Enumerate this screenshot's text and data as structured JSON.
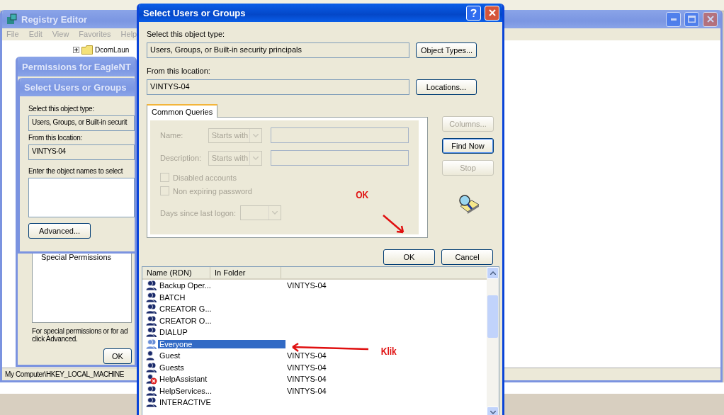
{
  "registry_editor": {
    "title": "Registry Editor",
    "menu": [
      "File",
      "Edit",
      "View",
      "Favorites",
      "Help"
    ],
    "tree_item": "DcomLaun",
    "status": "My Computer\\HKEY_LOCAL_MACHINE"
  },
  "permissions": {
    "title": "Permissions for EagleNT",
    "list_items": [
      "Special Permissions"
    ],
    "note_lines": [
      "For special permissions or for ad",
      "click Advanced."
    ],
    "ok": "OK"
  },
  "back_dialog": {
    "title": "Select Users or Groups",
    "object_type_label": "Select this object type:",
    "object_type": "Users, Groups, or Built-in securit",
    "location_label": "From this location:",
    "location": "VINTYS-04",
    "names_label": "Enter the object names to select",
    "advanced": "Advanced..."
  },
  "dialog": {
    "title": "Select Users or Groups",
    "object_type_label": "Select this object type:",
    "object_type": "Users, Groups, or Built-in security principals",
    "object_types_button": "Object Types...",
    "location_label": "From this location:",
    "location": "VINTYS-04",
    "locations_button": "Locations...",
    "tabs": [
      {
        "label": "Common Queries",
        "selected": true
      }
    ],
    "queries": [
      {
        "label": "Name:",
        "operator": "Starts with"
      },
      {
        "label": "Description:",
        "operator": "Starts with"
      }
    ],
    "checkboxes": [
      {
        "label": "Disabled accounts",
        "checked": false
      },
      {
        "label": "Non expiring password",
        "checked": false
      }
    ],
    "days_label": "Days since last logon:",
    "side_buttons": [
      {
        "label": "Columns...",
        "disabled": true
      },
      {
        "label": "Find Now",
        "disabled": false
      },
      {
        "label": "Stop",
        "disabled": true
      }
    ],
    "ok": "OK",
    "cancel": "Cancel",
    "columns": [
      "Name (RDN)",
      "In Folder"
    ],
    "rows": [
      {
        "name": "Backup Oper...",
        "folder": "VINTYS-04",
        "kind": "group",
        "selected": false
      },
      {
        "name": "BATCH",
        "kind": "group",
        "selected": false
      },
      {
        "name": "CREATOR G...",
        "kind": "group",
        "selected": false
      },
      {
        "name": "CREATOR O...",
        "kind": "group",
        "selected": false
      },
      {
        "name": "DIALUP",
        "kind": "group",
        "selected": false
      },
      {
        "name": "Everyone",
        "kind": "group",
        "selected": true
      },
      {
        "name": "Guest",
        "folder": "VINTYS-04",
        "kind": "user",
        "selected": false
      },
      {
        "name": "Guests",
        "folder": "VINTYS-04",
        "kind": "group",
        "selected": false
      },
      {
        "name": "HelpAssistant",
        "folder": "VINTYS-04",
        "kind": "disabled_user",
        "selected": false
      },
      {
        "name": "HelpServices...",
        "folder": "VINTYS-04",
        "kind": "group",
        "selected": false
      },
      {
        "name": "INTERACTIVE",
        "kind": "group",
        "selected": false
      }
    ]
  },
  "annotations": [
    {
      "text": "OK"
    },
    {
      "text": "Klik"
    }
  ]
}
